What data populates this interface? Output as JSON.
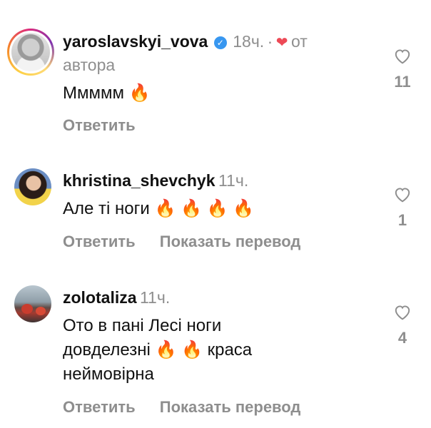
{
  "comments": [
    {
      "username": "yaroslavskyi_vova",
      "time": "18ч.",
      "dot": "·",
      "author_tag_prefix": "от",
      "author_tag_suffix": "автора",
      "text": "Ммммм",
      "emojis": [
        "🔥"
      ],
      "reply_label": "Ответить",
      "likes": "11"
    },
    {
      "username": "khristina_shevchyk",
      "time": "11ч.",
      "text": "Але ті ноги",
      "emojis": [
        "🔥",
        "🔥",
        "🔥",
        "🔥"
      ],
      "reply_label": "Ответить",
      "translate_label": "Показать перевод",
      "likes": "1"
    },
    {
      "username": "zolotaliza",
      "time": "11ч.",
      "text_line1": "Ото в пані Лесі ноги",
      "text_line2_start": "довделезні",
      "text_line2_end": "краса",
      "text_line3": "неймовірна",
      "emojis": [
        "🔥",
        "🔥"
      ],
      "reply_label": "Ответить",
      "translate_label": "Показать перевод",
      "likes": "4"
    }
  ],
  "icons": {
    "verified": "verified-badge-icon",
    "author_like": "red-heart-icon",
    "like": "heart-outline-icon"
  },
  "colors": {
    "verified": "#3897f0",
    "heart_red": "#ed4956",
    "muted": "#8e8e8e"
  }
}
